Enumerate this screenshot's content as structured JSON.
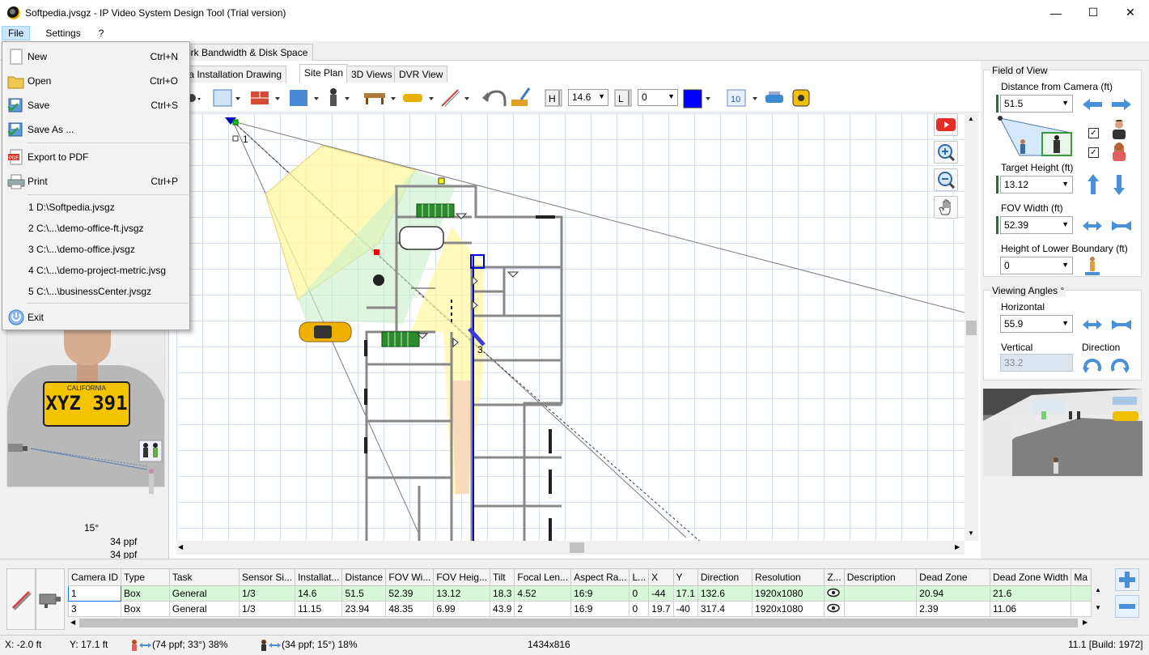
{
  "window": {
    "title": "Softpedia.jvsgz - IP Video System Design Tool (Trial version)",
    "minimize": "—",
    "maximize": "☐",
    "close": "✕"
  },
  "menubar": {
    "file": "File",
    "settings": "Settings",
    "help": "?"
  },
  "top_tabs": {
    "bandwidth": "ork Bandwidth & Disk Space"
  },
  "view_tabs": {
    "installation": "nera Installation Drawing",
    "site_plan": "Site Plan",
    "views3d": "3D Views",
    "dvr": "DVR View"
  },
  "toolbar": {
    "height_value": "14.6",
    "lower_value": "0",
    "grid_value": "10",
    "color": "#0000ff"
  },
  "file_menu": {
    "new": {
      "label": "New",
      "shortcut": "Ctrl+N"
    },
    "open": {
      "label": "Open",
      "shortcut": "Ctrl+O"
    },
    "save": {
      "label": "Save",
      "shortcut": "Ctrl+S"
    },
    "save_as": {
      "label": "Save As ..."
    },
    "export_pdf": {
      "label": "Export to PDF"
    },
    "print": {
      "label": "Print",
      "shortcut": "Ctrl+P"
    },
    "recent": [
      "1 D:\\Softpedia.jvsgz",
      "2 C:\\...\\demo-office-ft.jvsgz",
      "3 C:\\...\\demo-office.jvsgz",
      "4 C:\\...\\demo-project-metric.jvsg",
      "5 C:\\...\\businessCenter.jvsgz"
    ],
    "exit": {
      "label": "Exit"
    }
  },
  "left_panel": {
    "plate_state": "CALIFORNIA",
    "plate_number": "XYZ 391",
    "angle_label": "15°",
    "ppf_1": "34 ppf",
    "ppf_2": "34 ppf"
  },
  "right_panel": {
    "fov_title": "Field of View",
    "distance_label": "Distance from Camera  (ft)",
    "distance_value": "51.5",
    "target_height_label": "Target Height (ft)",
    "target_height_value": "13.12",
    "fov_width_label": "FOV Width (ft)",
    "fov_width_value": "52.39",
    "lower_boundary_label": "Height of Lower Boundary  (ft)",
    "lower_boundary_value": "0",
    "angles_title": "Viewing Angles °",
    "horizontal_label": "Horizontal",
    "horizontal_value": "55.9",
    "vertical_label": "Vertical",
    "vertical_value": "33.2",
    "direction_label": "Direction"
  },
  "plan_labels": {
    "cam1": "1",
    "cam3": "3"
  },
  "grid": {
    "columns": [
      "Camera ID",
      "Type",
      "Task",
      "Sensor Si...",
      "Installat...",
      "Distance",
      "FOV Wi...",
      "FOV Heig...",
      "Tilt",
      "Focal Len...",
      "Aspect Ra...",
      "L...",
      "X",
      "Y",
      "Direction",
      "Resolution",
      "Z...",
      "Description",
      "Dead Zone",
      "Dead Zone Width",
      "Ma"
    ],
    "rows": [
      [
        "1",
        "Box",
        "General",
        "1/3",
        "14.6",
        "51.5",
        "52.39",
        "13.12",
        "18.3",
        "4.52",
        "16:9",
        "0",
        "-44",
        "17.1",
        "132.6",
        "1920x1080",
        "eye",
        "",
        "20.94",
        "21.6",
        ""
      ],
      [
        "3",
        "Box",
        "General",
        "1/3",
        "11.15",
        "23.94",
        "48.35",
        "6.99",
        "43.9",
        "2",
        "16:9",
        "0",
        "19.7",
        "-40",
        "317.4",
        "1920x1080",
        "eye",
        "",
        "2.39",
        "11.06",
        ""
      ]
    ]
  },
  "status": {
    "x": "X: -2.0 ft",
    "y": "Y: 17.1 ft",
    "ppf_a": "(74 ppf; 33°) 38%",
    "ppf_b": "(34 ppf; 15°) 18%",
    "size": "1434x816",
    "build": "11.1 [Build: 1972]"
  }
}
